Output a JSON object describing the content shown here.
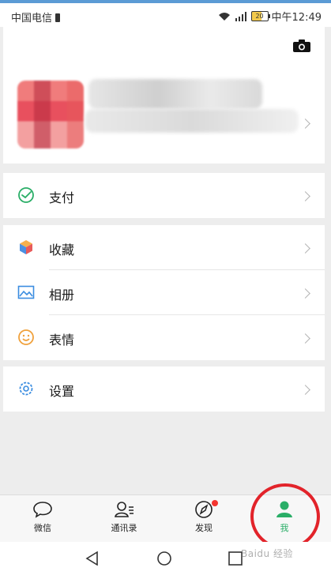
{
  "status_bar": {
    "carrier": "中国电信",
    "battery": "20",
    "time": "中午12:49"
  },
  "profile": {
    "camera_icon": "camera-icon"
  },
  "menu": {
    "pay": "支付",
    "favorites": "收藏",
    "album": "相册",
    "stickers": "表情",
    "settings": "设置"
  },
  "tabs": {
    "chats": "微信",
    "contacts": "通讯录",
    "discover": "发现",
    "me": "我"
  },
  "colors": {
    "accent": "#2aae67",
    "highlight": "#e2232a"
  },
  "watermark": "Baidu 经验"
}
